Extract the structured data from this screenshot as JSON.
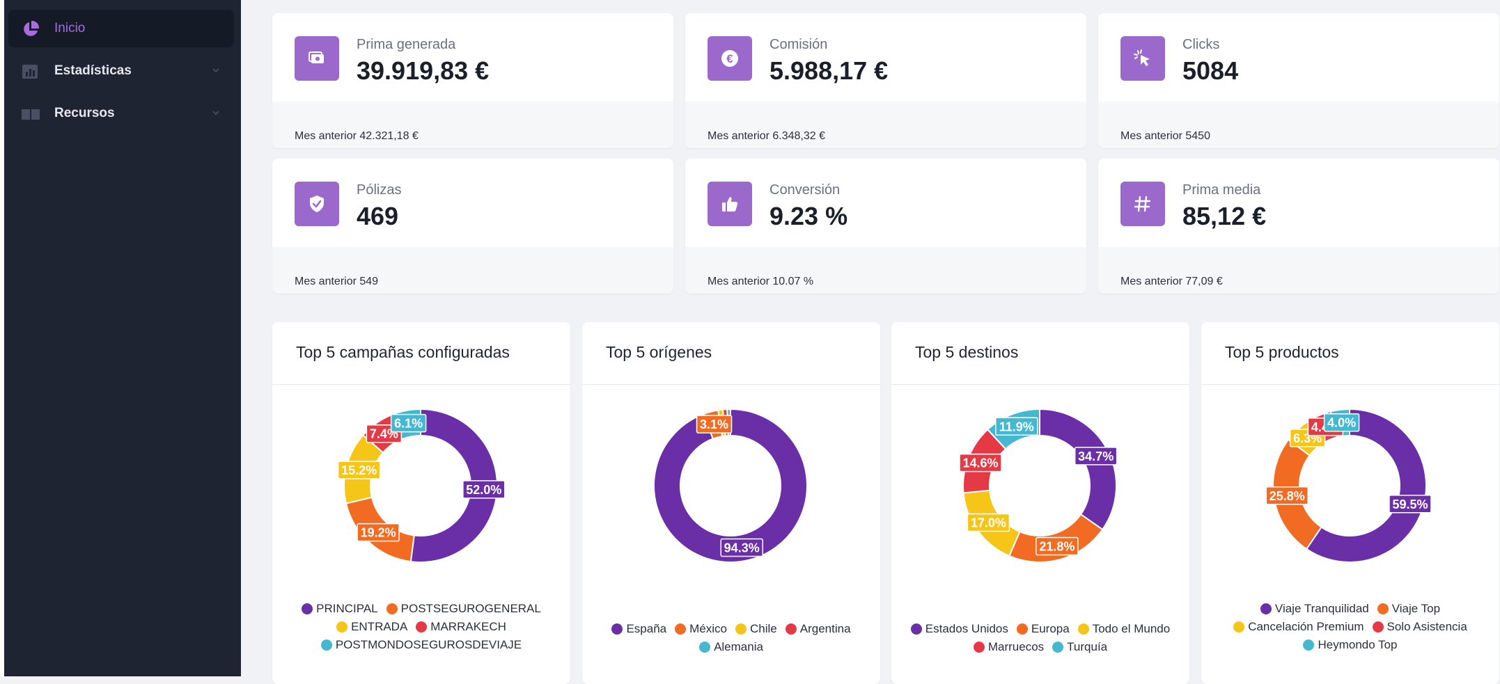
{
  "sidebar": {
    "items": [
      {
        "label": "Inicio",
        "icon": "pie-chart-icon",
        "active": true
      },
      {
        "label": "Estadísticas",
        "icon": "bar-chart-icon",
        "active": false
      },
      {
        "label": "Recursos",
        "icon": "book-icon",
        "active": false
      }
    ]
  },
  "stats": [
    {
      "label": "Prima generada",
      "value": "39.919,83 €",
      "prev": "Mes anterior 42.321,18 €",
      "icon": "money-icon"
    },
    {
      "label": "Comisión",
      "value": "5.988,17 €",
      "prev": "Mes anterior 6.348,32 €",
      "icon": "euro-icon"
    },
    {
      "label": "Clicks",
      "value": "5084",
      "prev": "Mes anterior 5450",
      "icon": "cursor-click-icon"
    },
    {
      "label": "Pólizas",
      "value": "469",
      "prev": "Mes anterior 549",
      "icon": "shield-check-icon"
    },
    {
      "label": "Conversión",
      "value": "9.23 %",
      "prev": "Mes anterior 10.07 %",
      "icon": "thumbs-up-icon"
    },
    {
      "label": "Prima media",
      "value": "85,12 €",
      "prev": "Mes anterior 77,09 €",
      "icon": "hash-icon"
    }
  ],
  "colors": {
    "purple": "#6a2fa6",
    "orange": "#f26b22",
    "yellow": "#f5c518",
    "red": "#e53946",
    "teal": "#44b7d1",
    "accent": "#9b68cc",
    "sidebar_bg": "#1f2433"
  },
  "chart_data": [
    {
      "type": "pie",
      "title": "Top 5 campañas configuradas",
      "series": [
        {
          "name": "PRINCIPAL",
          "value": 52.0,
          "label": "52.0%",
          "color": "#6a2fa6"
        },
        {
          "name": "POSTSEGUROGENERAL",
          "value": 19.2,
          "label": "19.2%",
          "color": "#f26b22"
        },
        {
          "name": "ENTRADA",
          "value": 15.2,
          "label": "15.2%",
          "color": "#f5c518"
        },
        {
          "name": "MARRAKECH",
          "value": 7.4,
          "label": "7.4%",
          "color": "#e53946"
        },
        {
          "name": "POSTMONDOSEGUROSDEVIAJE",
          "value": 6.1,
          "label": "6.1%",
          "color": "#44b7d1"
        }
      ]
    },
    {
      "type": "pie",
      "title": "Top 5 orígenes",
      "series": [
        {
          "name": "España",
          "value": 94.3,
          "label": "94.3%",
          "color": "#6a2fa6"
        },
        {
          "name": "México",
          "value": 3.1,
          "label": "3.1%",
          "color": "#f26b22"
        },
        {
          "name": "Chile",
          "value": 1.0,
          "label": "",
          "color": "#f5c518"
        },
        {
          "name": "Argentina",
          "value": 0.9,
          "label": "",
          "color": "#e53946"
        },
        {
          "name": "Alemania",
          "value": 0.7,
          "label": "",
          "color": "#44b7d1"
        }
      ]
    },
    {
      "type": "pie",
      "title": "Top 5 destinos",
      "series": [
        {
          "name": "Estados Unidos",
          "value": 34.7,
          "label": "34.7%",
          "color": "#6a2fa6"
        },
        {
          "name": "Europa",
          "value": 21.8,
          "label": "21.8%",
          "color": "#f26b22"
        },
        {
          "name": "Todo el Mundo",
          "value": 17.0,
          "label": "17.0%",
          "color": "#f5c518"
        },
        {
          "name": "Marruecos",
          "value": 14.6,
          "label": "14.6%",
          "color": "#e53946"
        },
        {
          "name": "Turquía",
          "value": 11.9,
          "label": "11.9%",
          "color": "#44b7d1"
        }
      ]
    },
    {
      "type": "pie",
      "title": "Top 5 productos",
      "series": [
        {
          "name": "Viaje Tranquilidad",
          "value": 59.5,
          "label": "59.5%",
          "color": "#6a2fa6"
        },
        {
          "name": "Viaje Top",
          "value": 25.8,
          "label": "25.8%",
          "color": "#f26b22"
        },
        {
          "name": "Cancelación Premium",
          "value": 6.3,
          "label": "6.3%",
          "color": "#f5c518"
        },
        {
          "name": "Solo Asistencia",
          "value": 4.4,
          "label": "4.4%",
          "color": "#e53946"
        },
        {
          "name": "Heymondo Top",
          "value": 4.0,
          "label": "4.0%",
          "color": "#44b7d1"
        }
      ]
    }
  ]
}
